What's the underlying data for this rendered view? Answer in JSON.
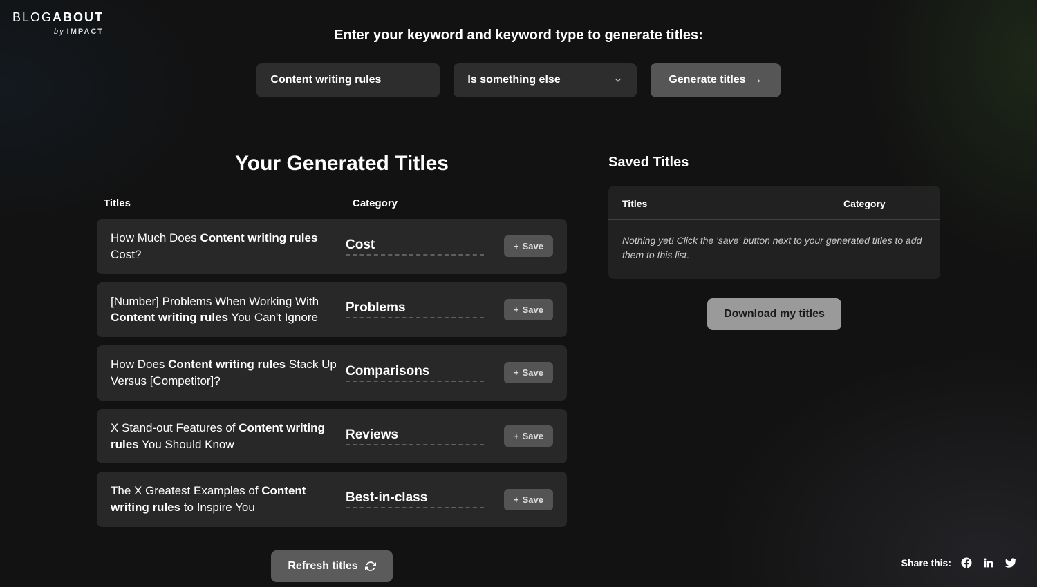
{
  "brand": {
    "name_pre": "BLOG",
    "name_bold": "ABOUT",
    "byline_by": "by",
    "byline_brand": "IMPACT"
  },
  "hero": {
    "heading": "Enter your keyword and keyword type to generate titles:",
    "keyword_value": "Content writing rules",
    "select_value": "Is something else",
    "generate_label": "Generate titles"
  },
  "sections": {
    "generated_heading": "Your Generated Titles",
    "col_title": "Titles",
    "col_category": "Category",
    "save_label": "Save",
    "refresh_label": "Refresh titles",
    "saved_heading": "Saved Titles",
    "saved_col_title": "Titles",
    "saved_col_category": "Category",
    "saved_empty": "Nothing yet! Click the 'save' button next to your generated titles to add them to this list.",
    "download_label": "Download my titles"
  },
  "titles": [
    {
      "pre": "How Much Does ",
      "kw": "Content writing rules",
      "post": " Cost?",
      "category": "Cost"
    },
    {
      "pre": "[Number] Problems When Working With ",
      "kw": "Content writing rules",
      "post": " You Can't Ignore",
      "category": "Problems"
    },
    {
      "pre": "How Does ",
      "kw": "Content writing rules",
      "post": " Stack Up Versus [Competitor]?",
      "category": "Comparisons"
    },
    {
      "pre": "X Stand-out Features of ",
      "kw": "Content writing rules",
      "post": " You Should Know",
      "category": "Reviews"
    },
    {
      "pre": "The X Greatest Examples of ",
      "kw": "Content writing rules",
      "post": " to Inspire You",
      "category": "Best-in-class"
    }
  ],
  "share": {
    "label": "Share this:"
  }
}
